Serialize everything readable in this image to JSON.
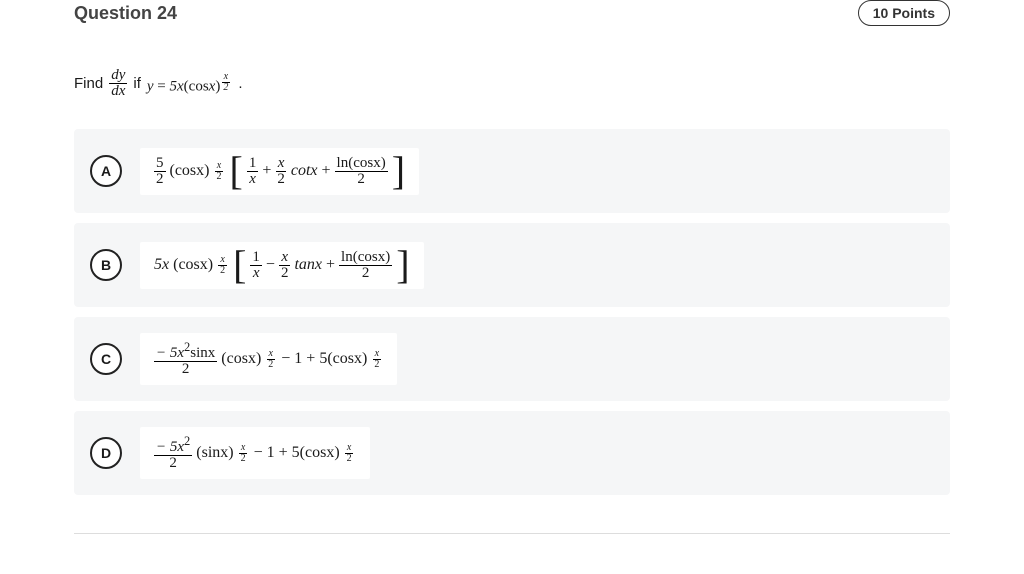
{
  "header": {
    "title": "Question 24",
    "points": "10 Points"
  },
  "prompt": {
    "lead": "Find",
    "if_text": "if",
    "eq_lhs": "y",
    "eq_rhs_coef": "5x",
    "eq_rhs_func": "(cos",
    "eq_rhs_arg": "x",
    "eq_rhs_close": ")",
    "period": "."
  },
  "fracs": {
    "dy": "dy",
    "dx": "dx",
    "x": "x",
    "two": "2",
    "five": "5",
    "one": "1"
  },
  "options": {
    "A": {
      "letter": "A",
      "lead_num": "5",
      "lead_den": "2",
      "base": "(cosx)",
      "t1_num": "1",
      "t1_den": "x",
      "op1": "+",
      "t2_num": "x",
      "t2_den": "2",
      "func2": "cotx",
      "op2": "+",
      "t3_top": "ln(cosx)",
      "t3_bot": "2"
    },
    "B": {
      "letter": "B",
      "lead": "5x",
      "base": "(cosx)",
      "t1_num": "1",
      "t1_den": "x",
      "op1": "−",
      "t2_num": "x",
      "t2_den": "2",
      "func2": "tanx",
      "op2": "+",
      "t3_top": "ln(cosx)",
      "t3_bot": "2"
    },
    "C": {
      "letter": "C",
      "num": "− 5x",
      "num_sup": "2",
      "num_tail": "sinx",
      "den": "2",
      "base": "(cosx)",
      "mid": "− 1 + 5(cosx)"
    },
    "D": {
      "letter": "D",
      "num": "− 5x",
      "num_sup": "2",
      "den": "2",
      "base": "(sinx)",
      "mid": "− 1 + 5(cosx)"
    }
  }
}
